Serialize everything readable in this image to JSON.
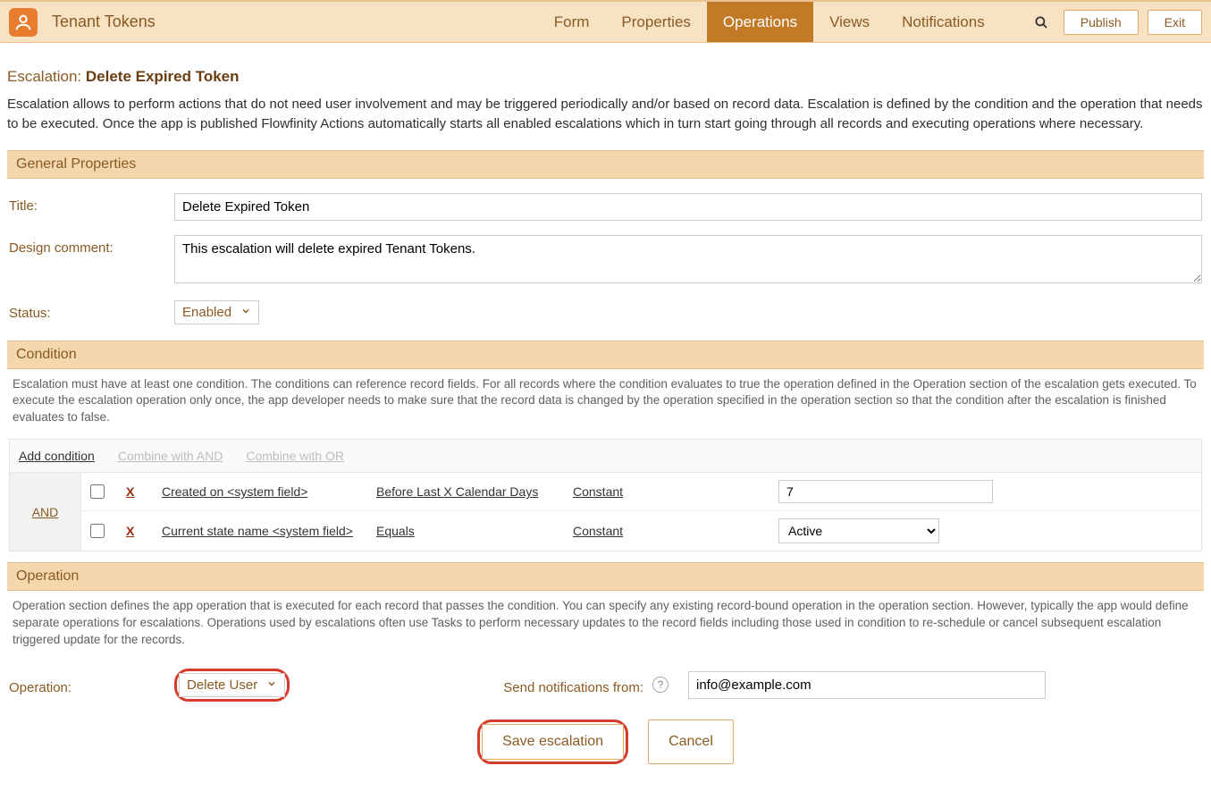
{
  "header": {
    "app_title": "Tenant Tokens",
    "tabs": [
      "Form",
      "Properties",
      "Operations",
      "Views",
      "Notifications"
    ],
    "active_tab_index": 2,
    "publish_label": "Publish",
    "exit_label": "Exit"
  },
  "page": {
    "title_prefix": "Escalation: ",
    "title_name": "Delete Expired Token",
    "description": "Escalation allows to perform actions that do not need user involvement and may be triggered periodically and/or based on record data. Escalation is defined by the condition and the operation that needs to be executed. Once the app is published Flowfinity Actions automatically starts all enabled escalations which in turn start going through all records and executing operations where necessary."
  },
  "sections": {
    "general": {
      "header": "General Properties",
      "title_label": "Title:",
      "title_value": "Delete Expired Token",
      "design_comment_label": "Design comment:",
      "design_comment_value": "This escalation will delete expired Tenant Tokens.",
      "status_label": "Status:",
      "status_value": "Enabled"
    },
    "condition": {
      "header": "Condition",
      "hint": "Escalation must have at least one condition. The conditions can reference record fields. For all records where the condition evaluates to true the operation defined in the Operation section of the escalation gets executed. To execute the escalation operation only once, the app developer needs to make sure that the record data is changed by the operation specified in the operation section so that the condition after the escalation is finished evaluates to false.",
      "toolbar": {
        "add": "Add condition",
        "and": "Combine with AND",
        "or": "Combine with OR"
      },
      "combiner": "AND",
      "rows": [
        {
          "field": "Created on <system field>",
          "op": "Before Last X Calendar Days",
          "src": "Constant",
          "value_type": "text",
          "value": "7"
        },
        {
          "field": "Current state name <system field>",
          "op": "Equals",
          "src": "Constant",
          "value_type": "select",
          "value": "Active"
        }
      ]
    },
    "operation": {
      "header": "Operation",
      "hint": "Operation section defines the app operation that is executed for each record that passes the condition. You can specify any existing record-bound operation in the operation section. However, typically the app would define separate operations for escalations. Operations used by escalations often use Tasks to perform necessary updates to the record fields including those used in condition to re-schedule or cancel subsequent escalation triggered update for the records.",
      "operation_label": "Operation:",
      "operation_value": "Delete User",
      "notify_label": "Send notifications from:",
      "notify_value": "info@example.com"
    }
  },
  "buttons": {
    "save": "Save escalation",
    "cancel": "Cancel"
  }
}
